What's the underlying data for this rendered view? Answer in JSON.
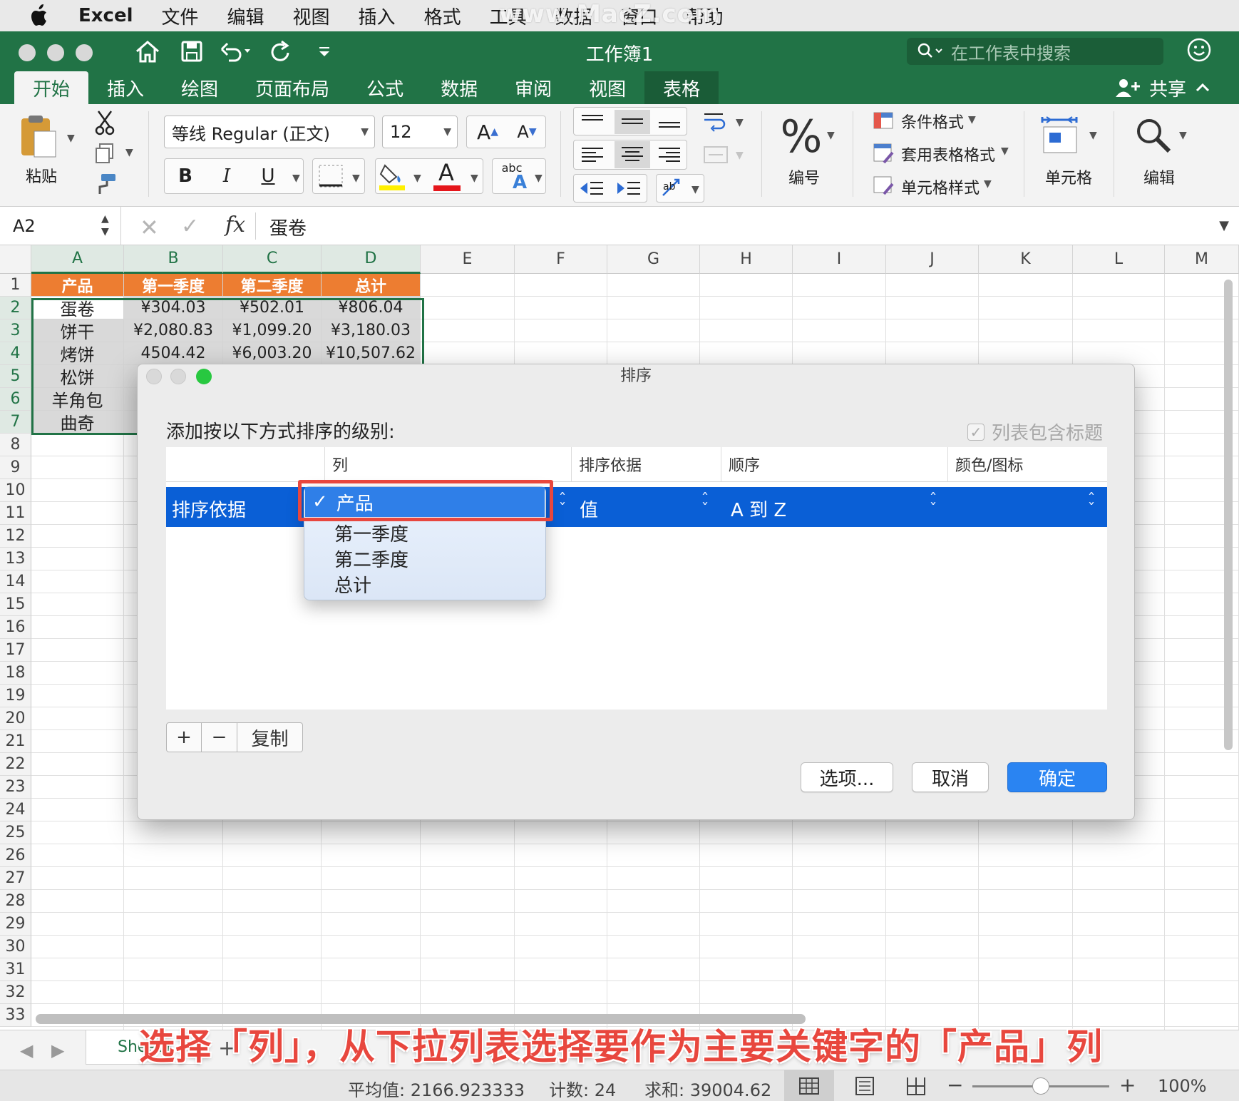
{
  "menubar": {
    "app": "Excel",
    "items": [
      "文件",
      "编辑",
      "视图",
      "插入",
      "格式",
      "工具",
      "数据",
      "窗口",
      "帮助"
    ],
    "watermark": "www.MacZ.com"
  },
  "window": {
    "title": "工作簿1",
    "search_placeholder": "在工作表中搜索"
  },
  "ribbon_tabs": [
    "开始",
    "插入",
    "绘图",
    "页面布局",
    "公式",
    "数据",
    "审阅",
    "视图",
    "表格"
  ],
  "share_label": "共享",
  "ribbon": {
    "paste_label": "粘贴",
    "font_name": "等线 Regular (正文)",
    "font_size": "12",
    "bold": "B",
    "italic": "I",
    "underline": "U",
    "number_format_label": "编号",
    "cond_format": "条件格式",
    "table_format": "套用表格格式",
    "cell_styles": "单元格样式",
    "cells_label": "单元格",
    "edit_label": "编辑",
    "percent_symbol": "%",
    "abc_text": "abc",
    "font_color_letter": "A"
  },
  "formula_bar": {
    "name_box": "A2",
    "fx": "fx",
    "content": "蛋卷"
  },
  "columns": [
    "A",
    "B",
    "C",
    "D",
    "E",
    "F",
    "G",
    "H",
    "I",
    "J",
    "K",
    "L",
    "M"
  ],
  "rows": [
    "1",
    "2",
    "3",
    "4",
    "5",
    "6",
    "7",
    "8",
    "9",
    "10",
    "11",
    "12",
    "13",
    "14",
    "15",
    "16",
    "17",
    "18",
    "19",
    "20",
    "21",
    "22",
    "23",
    "24",
    "25",
    "26",
    "27",
    "28",
    "29",
    "30",
    "31",
    "32",
    "33"
  ],
  "table": {
    "headers": [
      "产品",
      "第一季度",
      "第二季度",
      "总计"
    ],
    "rows": [
      [
        "蛋卷",
        "¥304.03",
        "¥502.01",
        "¥806.04"
      ],
      [
        "饼干",
        "¥2,080.83",
        "¥1,099.20",
        "¥3,180.03"
      ],
      [
        "烤饼",
        "4504.42",
        "¥6,003.20",
        "¥10,507.62"
      ],
      [
        "松饼",
        "",
        "",
        ""
      ],
      [
        "羊角包",
        "",
        "",
        ""
      ],
      [
        "曲奇",
        "",
        "",
        ""
      ]
    ]
  },
  "sheet": {
    "tab_name": "Sheet1"
  },
  "status": {
    "average": "平均值: 2166.923333",
    "count": "计数: 24",
    "sum": "求和: 39004.62",
    "zoom": "100%"
  },
  "dialog": {
    "title": "排序",
    "prompt": "添加按以下方式排序的级别:",
    "has_header_label": "列表包含标题",
    "columns_header": [
      "列",
      "排序依据",
      "顺序",
      "颜色/图标"
    ],
    "row_label": "排序依据",
    "column_value": "产品",
    "sort_on": "值",
    "order": "A 到 Z",
    "popup_options": [
      "第一季度",
      "第二季度",
      "总计"
    ],
    "copy_label": "复制",
    "options_button": "选项...",
    "cancel_button": "取消",
    "ok_button": "确定"
  },
  "caption": "选择「列」，从下拉列表选择要作为主要关键字的「产品」列",
  "colors": {
    "excel_green": "#217346",
    "header_orange": "#ed7d31",
    "selection_blue": "#0a5fd6",
    "highlight_red": "#e8473e"
  }
}
